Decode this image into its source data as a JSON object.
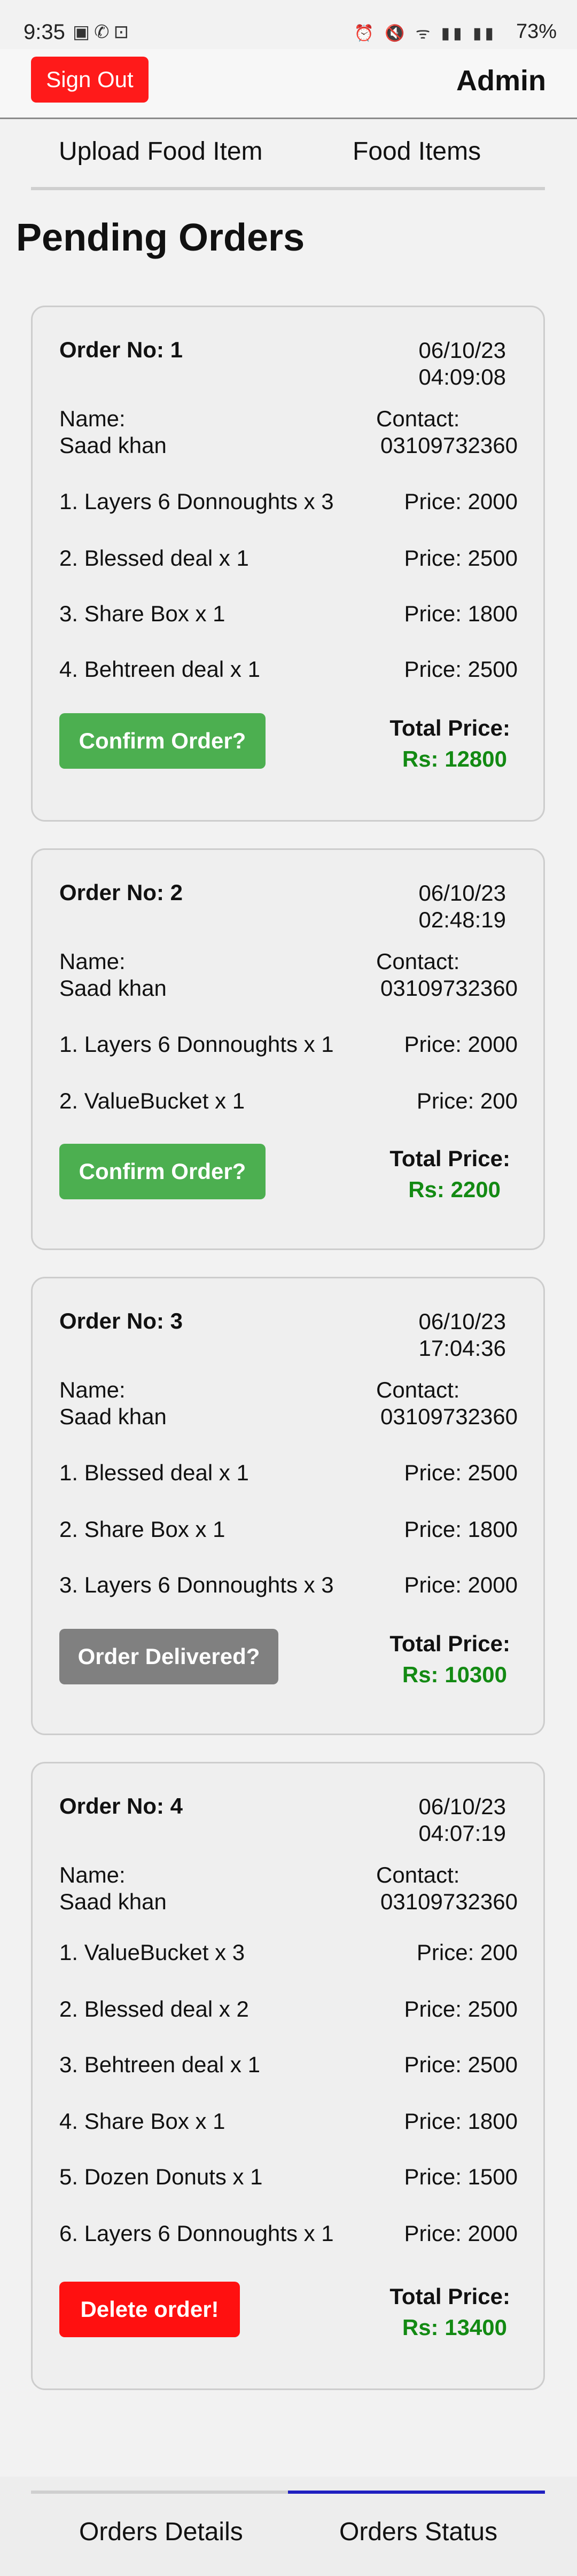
{
  "status": {
    "time": "9:35",
    "battery": "73%"
  },
  "header": {
    "signout": "Sign Out",
    "user": "Admin"
  },
  "top_tabs": [
    "Upload Food Item",
    "Food Items"
  ],
  "title": "Pending Orders",
  "labels": {
    "name": "Name:",
    "contact": "Contact:",
    "total": "Total Price:"
  },
  "orders": [
    {
      "no": "Order No: 1",
      "date": "06/10/23",
      "time": "04:09:08",
      "name": "Saad khan",
      "contact": "03109732360",
      "items": [
        {
          "text": "1. Layers 6 Donnoughts x 3",
          "price": "Price: 2000"
        },
        {
          "text": "2. Blessed deal x 1",
          "price": "Price: 2500"
        },
        {
          "text": "3. Share Box x 1",
          "price": "Price: 1800"
        },
        {
          "text": "4. Behtreen deal x 1",
          "price": "Price: 2500"
        }
      ],
      "button": "Confirm Order?",
      "total": "Rs: 12800"
    },
    {
      "no": "Order No: 2",
      "date": "06/10/23",
      "time": "02:48:19",
      "name": "Saad khan",
      "contact": "03109732360",
      "items": [
        {
          "text": "1. Layers 6 Donnoughts x 1",
          "price": "Price: 2000"
        },
        {
          "text": "2. ValueBucket x 1",
          "price": "Price: 200"
        }
      ],
      "button": "Confirm Order?",
      "total": "Rs: 2200"
    },
    {
      "no": "Order No: 3",
      "date": "06/10/23",
      "time": "17:04:36",
      "name": "Saad khan",
      "contact": "03109732360",
      "items": [
        {
          "text": "1. Blessed deal x 1",
          "price": "Price: 2500"
        },
        {
          "text": "2. Share Box x 1",
          "price": "Price: 1800"
        },
        {
          "text": "3. Layers 6 Donnoughts x 3",
          "price": "Price: 2000"
        }
      ],
      "button": "Order Delivered?",
      "total": "Rs: 10300"
    },
    {
      "no": "Order No: 4",
      "date": "06/10/23",
      "time": "04:07:19",
      "name": "Saad khan",
      "contact": "03109732360",
      "items": [
        {
          "text": "1. ValueBucket x 3",
          "price": "Price: 200"
        },
        {
          "text": "2. Blessed deal x 2",
          "price": "Price: 2500"
        },
        {
          "text": "3. Behtreen deal x 1",
          "price": "Price: 2500"
        },
        {
          "text": "4. Share Box x 1",
          "price": "Price: 1800"
        },
        {
          "text": "5. Dozen Donuts x 1",
          "price": "Price: 1500"
        },
        {
          "text": "6. Layers 6 Donnoughts x 1",
          "price": "Price: 2000"
        }
      ],
      "button": "Delete order!",
      "total": "Rs: 13400"
    }
  ],
  "bottom_tabs": [
    "Orders Details",
    "Orders Status"
  ],
  "colors": {
    "signout": "#ff1a1a",
    "confirm": "#4caf50",
    "delivered": "#808080",
    "delete": "#ff1010",
    "total": "#138a13",
    "active_tab": "#2020c0"
  }
}
